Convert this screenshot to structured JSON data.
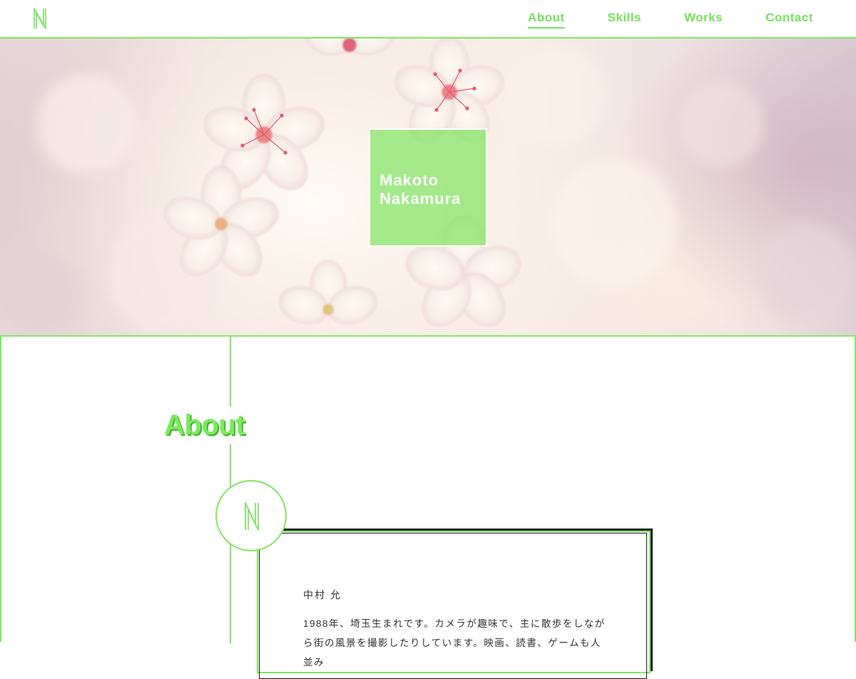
{
  "header": {
    "logo_icon": "mn-monogram-icon",
    "nav": [
      {
        "label": "About",
        "active": true
      },
      {
        "label": "Skills",
        "active": false
      },
      {
        "label": "Works",
        "active": false
      },
      {
        "label": "Contact",
        "active": false
      }
    ]
  },
  "hero": {
    "background": "cherry-blossom-photo",
    "name_line1": "Makoto",
    "name_line2": "Nakamura"
  },
  "about": {
    "title": "About",
    "avatar_icon": "mn-monogram-icon",
    "name": "中村 允",
    "bio": "1988年、埼玉生まれです。カメラが趣味で、主に散歩をしながら街の風景を撮影したりしています。映画、読書、ゲームも人並み"
  },
  "colors": {
    "accent": "#7de85f",
    "accent_dark": "#3fb82a",
    "text": "#333333",
    "card_shadow": "#1a1a1a"
  }
}
